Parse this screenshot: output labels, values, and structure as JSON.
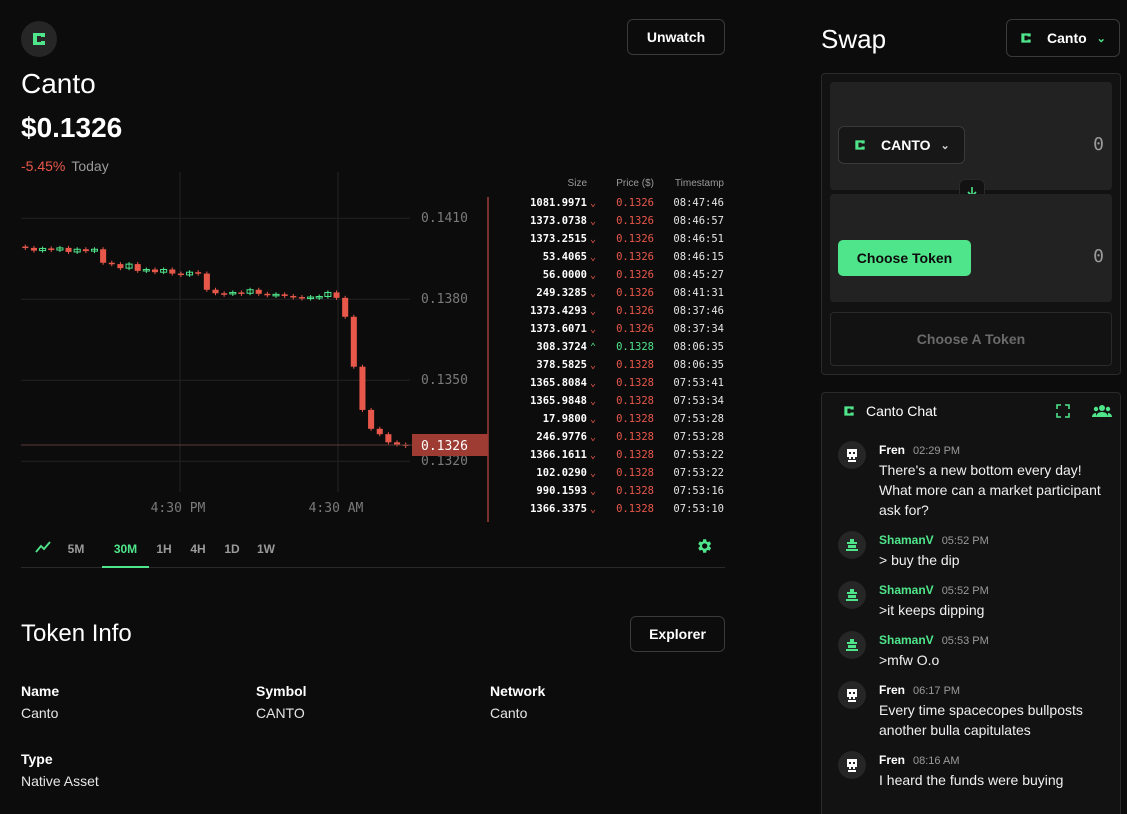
{
  "token": {
    "name": "Canto",
    "price": "$0.1326",
    "change": "-5.45%",
    "period": "Today",
    "unwatch_label": "Unwatch"
  },
  "chart": {
    "price_ticks": [
      "0.1410",
      "0.1380",
      "0.1350",
      "0.1320"
    ],
    "current_price_tag": "0.1326",
    "time_ticks": [
      "4:30 PM",
      "4:30 AM"
    ],
    "colors": {
      "up": "#4fe58a",
      "down": "#e8584a",
      "grid": "#232323"
    }
  },
  "chart_data": {
    "type": "candlestick",
    "ylim": [
      0.1316,
      0.1416
    ],
    "x_tick_labels": [
      "4:30 PM",
      "4:30 AM"
    ],
    "candles": [
      {
        "o": 0.13995,
        "c": 0.1399
      },
      {
        "o": 0.1399,
        "c": 0.1398
      },
      {
        "o": 0.1398,
        "c": 0.13988
      },
      {
        "o": 0.13988,
        "c": 0.13982
      },
      {
        "o": 0.13982,
        "c": 0.1399
      },
      {
        "o": 0.1399,
        "c": 0.13975
      },
      {
        "o": 0.13975,
        "c": 0.13985
      },
      {
        "o": 0.13985,
        "c": 0.13978
      },
      {
        "o": 0.13978,
        "c": 0.13985
      },
      {
        "o": 0.13985,
        "c": 0.13935
      },
      {
        "o": 0.13935,
        "c": 0.1393
      },
      {
        "o": 0.1393,
        "c": 0.13915
      },
      {
        "o": 0.13915,
        "c": 0.1393
      },
      {
        "o": 0.1393,
        "c": 0.13905
      },
      {
        "o": 0.13905,
        "c": 0.1391
      },
      {
        "o": 0.1391,
        "c": 0.139
      },
      {
        "o": 0.139,
        "c": 0.1391
      },
      {
        "o": 0.1391,
        "c": 0.13895
      },
      {
        "o": 0.13895,
        "c": 0.1389
      },
      {
        "o": 0.1389,
        "c": 0.139
      },
      {
        "o": 0.139,
        "c": 0.13895
      },
      {
        "o": 0.13895,
        "c": 0.13835
      },
      {
        "o": 0.13835,
        "c": 0.13822
      },
      {
        "o": 0.13822,
        "c": 0.1382
      },
      {
        "o": 0.1382,
        "c": 0.13825
      },
      {
        "o": 0.13825,
        "c": 0.13822
      },
      {
        "o": 0.13822,
        "c": 0.13835
      },
      {
        "o": 0.13835,
        "c": 0.1382
      },
      {
        "o": 0.1382,
        "c": 0.13815
      },
      {
        "o": 0.13815,
        "c": 0.13818
      },
      {
        "o": 0.13818,
        "c": 0.13812
      },
      {
        "o": 0.13812,
        "c": 0.13808
      },
      {
        "o": 0.13808,
        "c": 0.13805
      },
      {
        "o": 0.13805,
        "c": 0.13808
      },
      {
        "o": 0.13808,
        "c": 0.1381
      },
      {
        "o": 0.1381,
        "c": 0.13825
      },
      {
        "o": 0.13825,
        "c": 0.13805
      },
      {
        "o": 0.13805,
        "c": 0.13735
      },
      {
        "o": 0.13735,
        "c": 0.1355
      },
      {
        "o": 0.1355,
        "c": 0.1339
      },
      {
        "o": 0.1339,
        "c": 0.1332
      },
      {
        "o": 0.1332,
        "c": 0.133
      },
      {
        "o": 0.133,
        "c": 0.1327
      },
      {
        "o": 0.1327,
        "c": 0.13262
      },
      {
        "o": 0.13262,
        "c": 0.1326
      }
    ]
  },
  "trades": {
    "headers": {
      "size": "Size",
      "price": "Price ($)",
      "time": "Timestamp"
    },
    "rows": [
      {
        "size": "1081.9971",
        "price": "0.1326",
        "time": "08:47:46",
        "side": "sell"
      },
      {
        "size": "1373.0738",
        "price": "0.1326",
        "time": "08:46:57",
        "side": "sell"
      },
      {
        "size": "1373.2515",
        "price": "0.1326",
        "time": "08:46:51",
        "side": "sell"
      },
      {
        "size": "53.4065",
        "price": "0.1326",
        "time": "08:46:15",
        "side": "sell"
      },
      {
        "size": "56.0000",
        "price": "0.1326",
        "time": "08:45:27",
        "side": "sell"
      },
      {
        "size": "249.3285",
        "price": "0.1326",
        "time": "08:41:31",
        "side": "sell"
      },
      {
        "size": "1373.4293",
        "price": "0.1326",
        "time": "08:37:46",
        "side": "sell"
      },
      {
        "size": "1373.6071",
        "price": "0.1326",
        "time": "08:37:34",
        "side": "sell"
      },
      {
        "size": "308.3724",
        "price": "0.1328",
        "time": "08:06:35",
        "side": "buy"
      },
      {
        "size": "378.5825",
        "price": "0.1328",
        "time": "08:06:35",
        "side": "sell"
      },
      {
        "size": "1365.8084",
        "price": "0.1328",
        "time": "07:53:41",
        "side": "sell"
      },
      {
        "size": "1365.9848",
        "price": "0.1328",
        "time": "07:53:34",
        "side": "sell"
      },
      {
        "size": "17.9800",
        "price": "0.1328",
        "time": "07:53:28",
        "side": "sell"
      },
      {
        "size": "246.9776",
        "price": "0.1328",
        "time": "07:53:28",
        "side": "sell"
      },
      {
        "size": "1366.1611",
        "price": "0.1328",
        "time": "07:53:22",
        "side": "sell"
      },
      {
        "size": "102.0290",
        "price": "0.1328",
        "time": "07:53:22",
        "side": "sell"
      },
      {
        "size": "990.1593",
        "price": "0.1328",
        "time": "07:53:16",
        "side": "sell"
      },
      {
        "size": "1366.3375",
        "price": "0.1328",
        "time": "07:53:10",
        "side": "sell"
      }
    ]
  },
  "timeframes": [
    {
      "label": "5M",
      "active": false
    },
    {
      "label": "30M",
      "active": true
    },
    {
      "label": "1H",
      "active": false
    },
    {
      "label": "4H",
      "active": false
    },
    {
      "label": "1D",
      "active": false
    },
    {
      "label": "1W",
      "active": false
    }
  ],
  "token_info": {
    "title": "Token Info",
    "explorer_label": "Explorer",
    "fields": [
      {
        "label": "Name",
        "value": "Canto"
      },
      {
        "label": "Symbol",
        "value": "CANTO"
      },
      {
        "label": "Network",
        "value": "Canto"
      },
      {
        "label": "Type",
        "value": "Native Asset"
      }
    ]
  },
  "swap": {
    "title": "Swap",
    "chain": "Canto",
    "from_token": "CANTO",
    "from_amount": "0",
    "choose_token_label": "Choose Token",
    "to_amount": "0",
    "action_label": "Choose A Token"
  },
  "chat": {
    "title": "Canto Chat",
    "messages": [
      {
        "user": "Fren",
        "time": "02:29 PM",
        "text": "There's a new bottom every day! What more can  a market participant ask for?",
        "avatar": "skull-icon",
        "name_color": "#ffffff"
      },
      {
        "user": "ShamanV",
        "time": "05:52 PM",
        "text": "> buy the dip",
        "avatar": "totem-icon",
        "name_color": "#4fe58a"
      },
      {
        "user": "ShamanV",
        "time": "05:52 PM",
        "text": ">it keeps dipping",
        "avatar": "totem-icon",
        "name_color": "#4fe58a"
      },
      {
        "user": "ShamanV",
        "time": "05:53 PM",
        "text": ">mfw O.o",
        "avatar": "totem-icon",
        "name_color": "#4fe58a"
      },
      {
        "user": "Fren",
        "time": "06:17 PM",
        "text": "Every time spacecopes bullposts another bulla capitulates",
        "avatar": "skull-icon",
        "name_color": "#ffffff"
      },
      {
        "user": "Fren",
        "time": "08:16 AM",
        "text": "I heard the funds were buying",
        "avatar": "skull-icon",
        "name_color": "#ffffff"
      }
    ]
  }
}
